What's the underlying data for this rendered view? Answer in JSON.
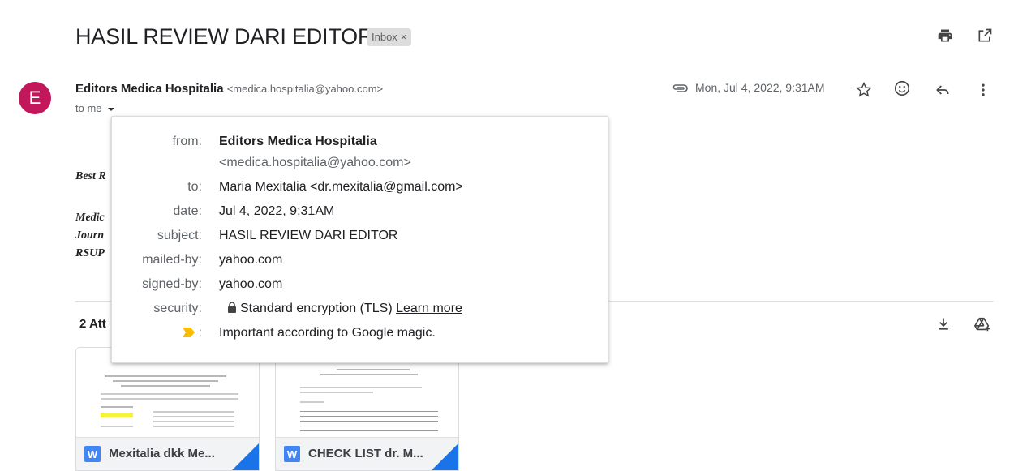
{
  "header": {
    "subject": "HASIL REVIEW DARI EDITOR",
    "label_chip": "Inbox",
    "label_remove": "×",
    "icons": [
      "print-icon",
      "open-in-new-window-icon"
    ]
  },
  "message": {
    "avatar_letter": "E",
    "avatar_color": "#c2185b",
    "sender_name": "Editors Medica Hospitalia",
    "sender_email": "<medica.hospitalia@yahoo.com>",
    "to_label": "to me",
    "date": "Mon, Jul 4, 2022, 9:31AM",
    "icons": [
      "attachment-icon",
      "star-icon",
      "emoji-reaction-icon",
      "reply-icon",
      "more-options-icon"
    ]
  },
  "body": {
    "line1": "Best R",
    "line2": "Medic",
    "line3": "Journ",
    "line4": "RSUP"
  },
  "details_popup": {
    "from_label": "from:",
    "from_name": "Editors Medica Hospitalia",
    "from_email": "<medica.hospitalia@yahoo.com>",
    "to_label": "to:",
    "to_value": "Maria Mexitalia <dr.mexitalia@gmail.com>",
    "date_label": "date:",
    "date_value": "Jul 4, 2022, 9:31AM",
    "subject_label": "subject:",
    "subject_value": "HASIL REVIEW DARI EDITOR",
    "mailedby_label": "mailed-by:",
    "mailedby_value": "yahoo.com",
    "signedby_label": "signed-by:",
    "signedby_value": "yahoo.com",
    "security_label": "security:",
    "security_value": "Standard encryption (TLS)",
    "security_link": "Learn more",
    "importance_label": ":",
    "importance_value": "Important according to Google magic.",
    "importance_color": "#fbbc04"
  },
  "attachments": {
    "title": "2 Att",
    "icons": [
      "download-all-icon",
      "add-to-drive-icon"
    ],
    "items": [
      {
        "type_letter": "W",
        "name": "Mexitalia dkk Me..."
      },
      {
        "type_letter": "W",
        "name": "CHECK LIST dr. M..."
      }
    ]
  }
}
